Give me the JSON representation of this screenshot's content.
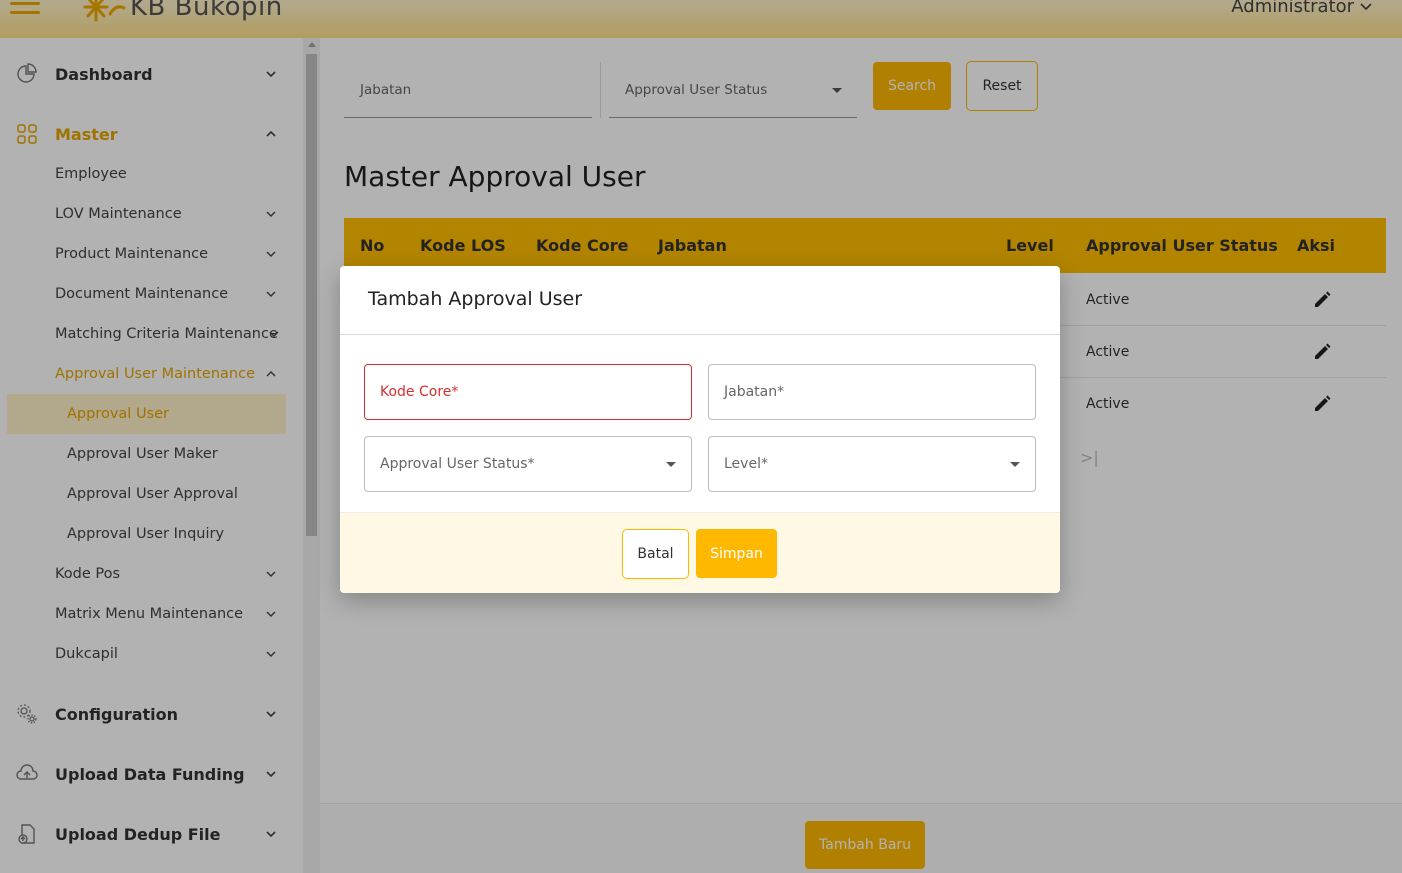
{
  "header": {
    "logo_text": "KB Bukopin",
    "user_label": "Administrator"
  },
  "colors": {
    "accent": "#ffb800",
    "active_text": "#e5a500",
    "active_bg": "#fff1c7",
    "error": "#d32f2f"
  },
  "sidebar": {
    "items": [
      {
        "label": "Dashboard",
        "icon": "pie-chart-icon"
      },
      {
        "label": "Master",
        "icon": "grid-icon"
      },
      {
        "label": "Employee"
      },
      {
        "label": "LOV Maintenance"
      },
      {
        "label": "Product Maintenance"
      },
      {
        "label": "Document Maintenance"
      },
      {
        "label": "Matching Criteria Maintenance"
      },
      {
        "label": "Approval User Maintenance"
      },
      {
        "label": "Approval User"
      },
      {
        "label": "Approval User Maker"
      },
      {
        "label": "Approval User Approval"
      },
      {
        "label": "Approval User Inquiry"
      },
      {
        "label": "Kode Pos"
      },
      {
        "label": "Matrix Menu Maintenance"
      },
      {
        "label": "Dukcapil"
      },
      {
        "label": "Configuration",
        "icon": "gears-icon"
      },
      {
        "label": "Upload Data Funding",
        "icon": "cloud-upload-icon"
      },
      {
        "label": "Upload Dedup File",
        "icon": "file-upload-icon"
      }
    ]
  },
  "filters": {
    "jabatan_placeholder": "Jabatan",
    "status_placeholder": "Approval User Status",
    "search_label": "Search",
    "reset_label": "Reset"
  },
  "page": {
    "title": "Master Approval User",
    "add_button": "Tambah Baru"
  },
  "table": {
    "columns": [
      "No",
      "Kode LOS",
      "Kode Core",
      "Jabatan",
      "Level",
      "Approval User Status",
      "Aksi"
    ],
    "rows": [
      {
        "status": "Active"
      },
      {
        "status": "Active"
      },
      {
        "status": "Active"
      }
    ],
    "pager_last": ">|"
  },
  "modal": {
    "title": "Tambah Approval User",
    "fields": {
      "kode_core": "Kode Core*",
      "jabatan": "Jabatan*",
      "status": "Approval User Status*",
      "level": "Level*"
    },
    "cancel_label": "Batal",
    "save_label": "Simpan"
  }
}
